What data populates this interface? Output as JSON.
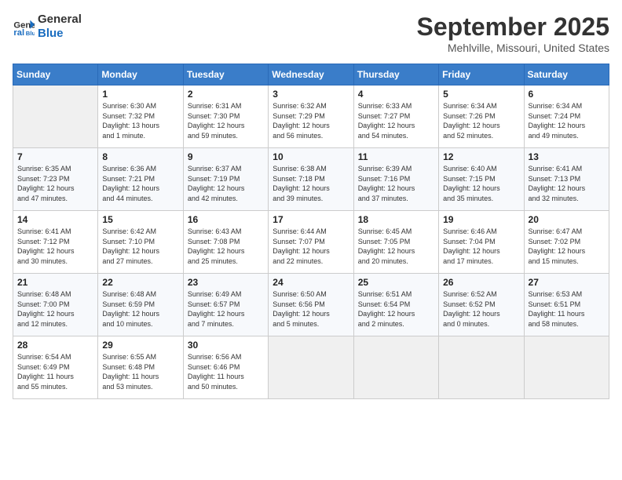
{
  "header": {
    "logo_line1": "General",
    "logo_line2": "Blue",
    "month_year": "September 2025",
    "location": "Mehlville, Missouri, United States"
  },
  "weekdays": [
    "Sunday",
    "Monday",
    "Tuesday",
    "Wednesday",
    "Thursday",
    "Friday",
    "Saturday"
  ],
  "weeks": [
    [
      {
        "day": "",
        "info": ""
      },
      {
        "day": "1",
        "info": "Sunrise: 6:30 AM\nSunset: 7:32 PM\nDaylight: 13 hours\nand 1 minute."
      },
      {
        "day": "2",
        "info": "Sunrise: 6:31 AM\nSunset: 7:30 PM\nDaylight: 12 hours\nand 59 minutes."
      },
      {
        "day": "3",
        "info": "Sunrise: 6:32 AM\nSunset: 7:29 PM\nDaylight: 12 hours\nand 56 minutes."
      },
      {
        "day": "4",
        "info": "Sunrise: 6:33 AM\nSunset: 7:27 PM\nDaylight: 12 hours\nand 54 minutes."
      },
      {
        "day": "5",
        "info": "Sunrise: 6:34 AM\nSunset: 7:26 PM\nDaylight: 12 hours\nand 52 minutes."
      },
      {
        "day": "6",
        "info": "Sunrise: 6:34 AM\nSunset: 7:24 PM\nDaylight: 12 hours\nand 49 minutes."
      }
    ],
    [
      {
        "day": "7",
        "info": "Sunrise: 6:35 AM\nSunset: 7:23 PM\nDaylight: 12 hours\nand 47 minutes."
      },
      {
        "day": "8",
        "info": "Sunrise: 6:36 AM\nSunset: 7:21 PM\nDaylight: 12 hours\nand 44 minutes."
      },
      {
        "day": "9",
        "info": "Sunrise: 6:37 AM\nSunset: 7:19 PM\nDaylight: 12 hours\nand 42 minutes."
      },
      {
        "day": "10",
        "info": "Sunrise: 6:38 AM\nSunset: 7:18 PM\nDaylight: 12 hours\nand 39 minutes."
      },
      {
        "day": "11",
        "info": "Sunrise: 6:39 AM\nSunset: 7:16 PM\nDaylight: 12 hours\nand 37 minutes."
      },
      {
        "day": "12",
        "info": "Sunrise: 6:40 AM\nSunset: 7:15 PM\nDaylight: 12 hours\nand 35 minutes."
      },
      {
        "day": "13",
        "info": "Sunrise: 6:41 AM\nSunset: 7:13 PM\nDaylight: 12 hours\nand 32 minutes."
      }
    ],
    [
      {
        "day": "14",
        "info": "Sunrise: 6:41 AM\nSunset: 7:12 PM\nDaylight: 12 hours\nand 30 minutes."
      },
      {
        "day": "15",
        "info": "Sunrise: 6:42 AM\nSunset: 7:10 PM\nDaylight: 12 hours\nand 27 minutes."
      },
      {
        "day": "16",
        "info": "Sunrise: 6:43 AM\nSunset: 7:08 PM\nDaylight: 12 hours\nand 25 minutes."
      },
      {
        "day": "17",
        "info": "Sunrise: 6:44 AM\nSunset: 7:07 PM\nDaylight: 12 hours\nand 22 minutes."
      },
      {
        "day": "18",
        "info": "Sunrise: 6:45 AM\nSunset: 7:05 PM\nDaylight: 12 hours\nand 20 minutes."
      },
      {
        "day": "19",
        "info": "Sunrise: 6:46 AM\nSunset: 7:04 PM\nDaylight: 12 hours\nand 17 minutes."
      },
      {
        "day": "20",
        "info": "Sunrise: 6:47 AM\nSunset: 7:02 PM\nDaylight: 12 hours\nand 15 minutes."
      }
    ],
    [
      {
        "day": "21",
        "info": "Sunrise: 6:48 AM\nSunset: 7:00 PM\nDaylight: 12 hours\nand 12 minutes."
      },
      {
        "day": "22",
        "info": "Sunrise: 6:48 AM\nSunset: 6:59 PM\nDaylight: 12 hours\nand 10 minutes."
      },
      {
        "day": "23",
        "info": "Sunrise: 6:49 AM\nSunset: 6:57 PM\nDaylight: 12 hours\nand 7 minutes."
      },
      {
        "day": "24",
        "info": "Sunrise: 6:50 AM\nSunset: 6:56 PM\nDaylight: 12 hours\nand 5 minutes."
      },
      {
        "day": "25",
        "info": "Sunrise: 6:51 AM\nSunset: 6:54 PM\nDaylight: 12 hours\nand 2 minutes."
      },
      {
        "day": "26",
        "info": "Sunrise: 6:52 AM\nSunset: 6:52 PM\nDaylight: 12 hours\nand 0 minutes."
      },
      {
        "day": "27",
        "info": "Sunrise: 6:53 AM\nSunset: 6:51 PM\nDaylight: 11 hours\nand 58 minutes."
      }
    ],
    [
      {
        "day": "28",
        "info": "Sunrise: 6:54 AM\nSunset: 6:49 PM\nDaylight: 11 hours\nand 55 minutes."
      },
      {
        "day": "29",
        "info": "Sunrise: 6:55 AM\nSunset: 6:48 PM\nDaylight: 11 hours\nand 53 minutes."
      },
      {
        "day": "30",
        "info": "Sunrise: 6:56 AM\nSunset: 6:46 PM\nDaylight: 11 hours\nand 50 minutes."
      },
      {
        "day": "",
        "info": ""
      },
      {
        "day": "",
        "info": ""
      },
      {
        "day": "",
        "info": ""
      },
      {
        "day": "",
        "info": ""
      }
    ]
  ]
}
